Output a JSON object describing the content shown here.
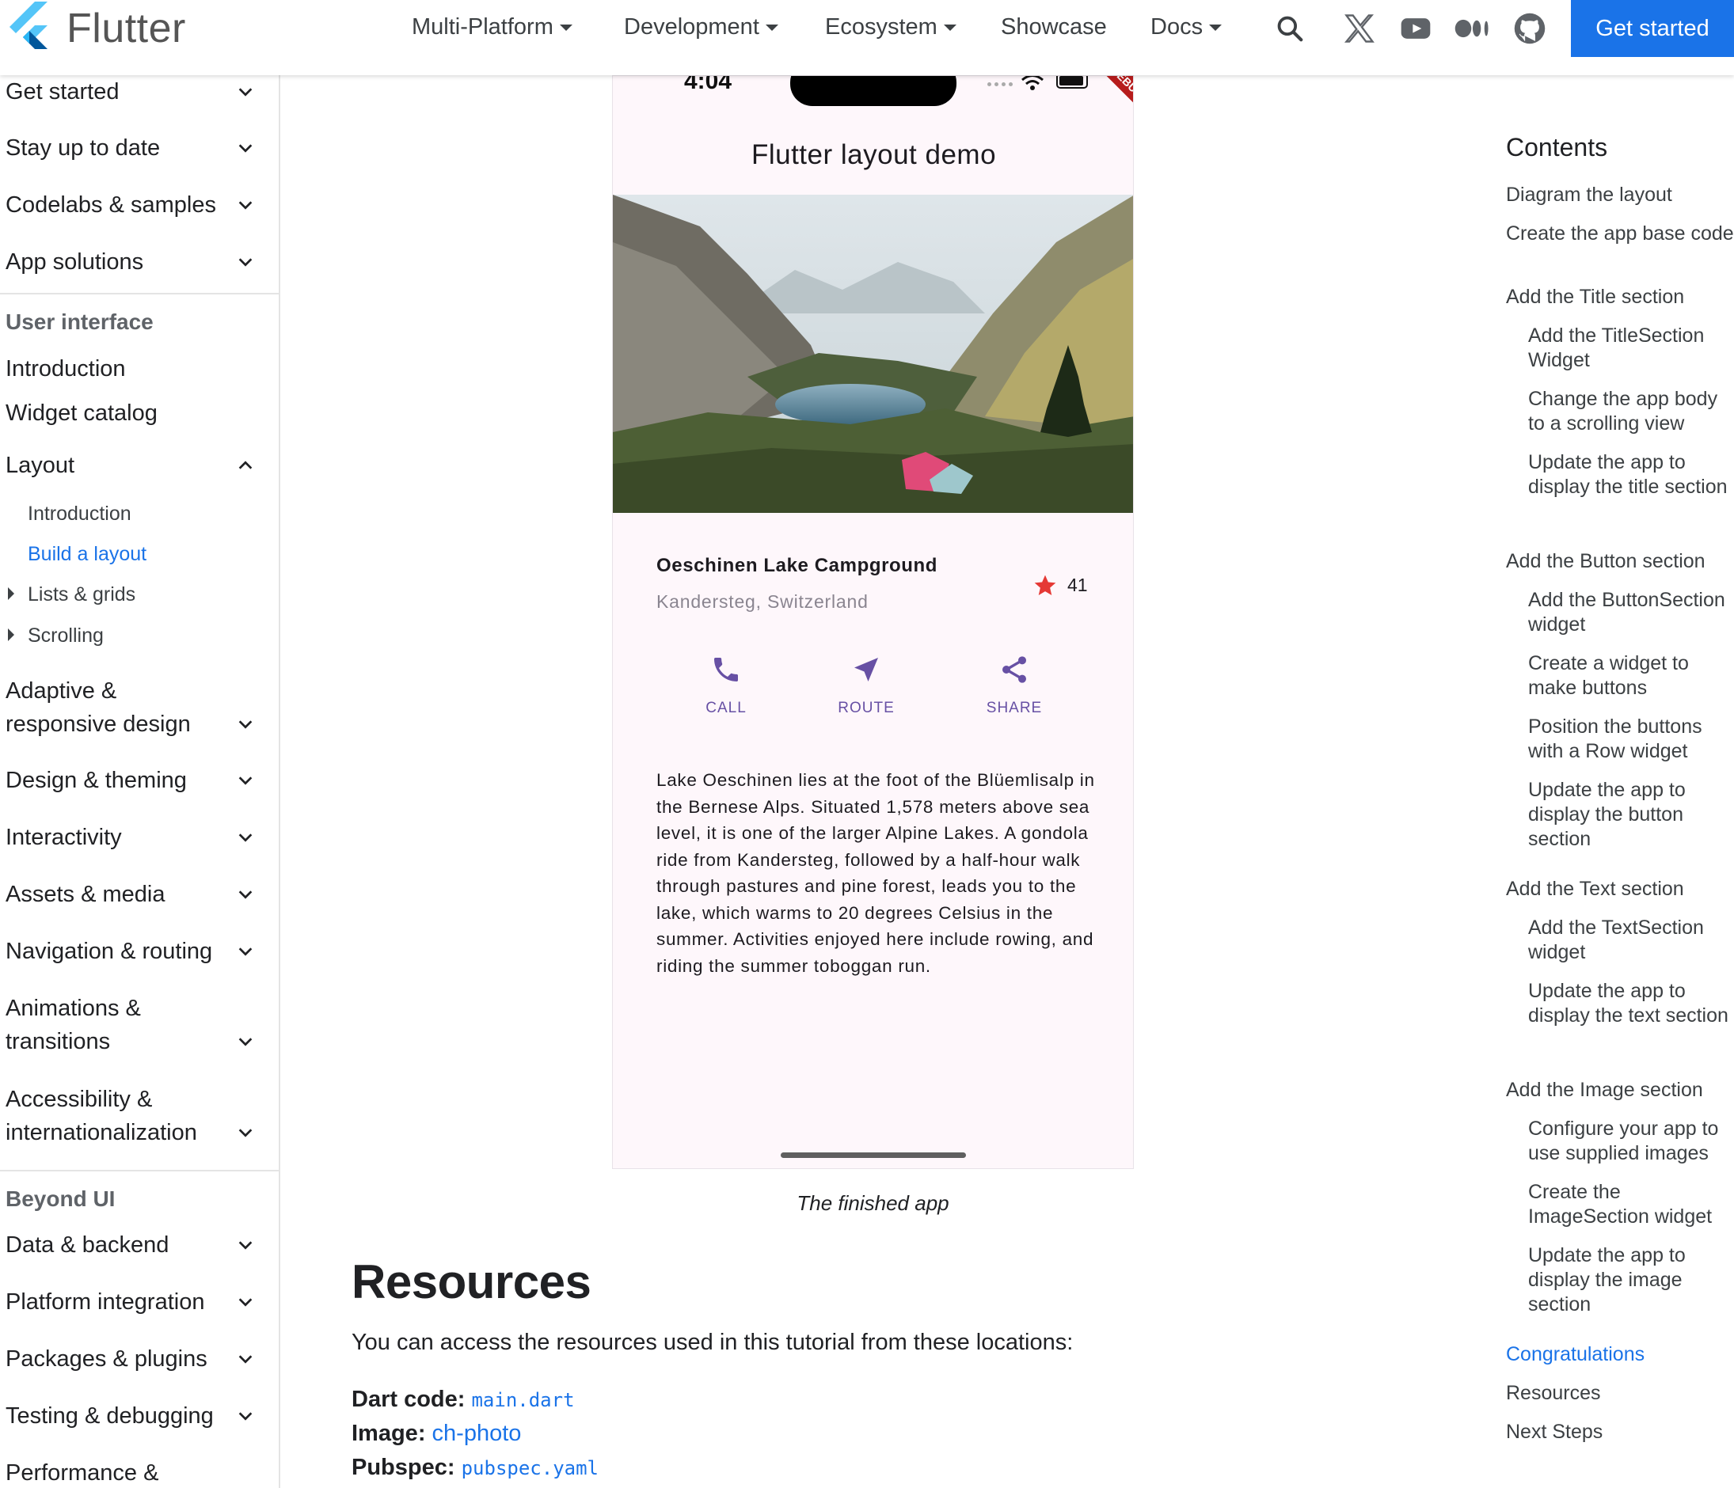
{
  "navbar": {
    "brand": "Flutter",
    "links": [
      {
        "label": "Multi-Platform",
        "dropdown": true
      },
      {
        "label": "Development",
        "dropdown": true
      },
      {
        "label": "Ecosystem",
        "dropdown": true
      },
      {
        "label": "Showcase",
        "dropdown": false
      },
      {
        "label": "Docs",
        "dropdown": true
      }
    ],
    "icons": [
      "search-icon",
      "x-icon",
      "youtube-icon",
      "medium-icon",
      "github-icon"
    ],
    "cta": "Get started"
  },
  "sidebar": {
    "top_items": [
      "Get started",
      "Stay up to date",
      "Codelabs & samples",
      "App solutions"
    ],
    "section1": "User interface",
    "ui_items": [
      "Introduction",
      "Widget catalog"
    ],
    "layout": {
      "label": "Layout",
      "children": [
        "Introduction",
        "Build a layout",
        "Lists & grids",
        "Scrolling"
      ]
    },
    "ui_more": [
      {
        "label": "Adaptive & responsive design",
        "line1": "Adaptive &",
        "line2": "responsive design"
      },
      {
        "label": "Design & theming"
      },
      {
        "label": "Interactivity"
      },
      {
        "label": "Assets & media"
      },
      {
        "label": "Navigation & routing"
      },
      {
        "label": "Animations & transitions",
        "line1": "Animations &",
        "line2": "transitions"
      },
      {
        "label": "Accessibility & internationalization",
        "line1": "Accessibility &",
        "line2": "internationalization"
      }
    ],
    "section2": "Beyond UI",
    "beyond_items": [
      "Data & backend",
      "Platform integration",
      "Packages & plugins",
      "Testing & debugging",
      "Performance &"
    ]
  },
  "phone": {
    "time": "4:04",
    "debug_banner": "DEBUG",
    "app_title": "Flutter layout demo",
    "place_name": "Oeschinen Lake Campground",
    "place_location": "Kandersteg, Switzerland",
    "star_count": "41",
    "actions": [
      "CALL",
      "ROUTE",
      "SHARE"
    ],
    "description": "Lake Oeschinen lies at the foot of the Blüemlisalp in the Bernese Alps. Situated 1,578 meters above sea level, it is one of the larger Alpine Lakes. A gondola ride from Kandersteg, followed by a half-hour walk through pastures and pine forest, leads you to the lake, which warms to 20 degrees Celsius in the summer. Activities enjoyed here include rowing, and riding the summer toboggan run."
  },
  "caption": "The finished app",
  "resources": {
    "heading": "Resources",
    "intro": "You can access the resources used in this tutorial from these locations:",
    "rows": [
      {
        "label": "Dart code:",
        "link": "main.dart"
      },
      {
        "label": "Image:",
        "link": "ch-photo"
      },
      {
        "label": "Pubspec:",
        "link": "pubspec.yaml"
      }
    ]
  },
  "toc": {
    "heading": "Contents",
    "items": [
      "Diagram the layout",
      "Create the app base code",
      "Add the Title section",
      "Add the TitleSection Widget",
      "Change the app body to a scrolling view",
      "Update the app to display the title section",
      "Add the Button section",
      "Add the ButtonSection widget",
      "Create a widget to make buttons",
      "Position the buttons with a Row widget",
      "Update the app to display the button section",
      "Add the Text section",
      "Add the TextSection widget",
      "Update the app to display the text section",
      "Add the Image section",
      "Configure your app to use supplied images",
      "Create the ImageSection widget",
      "Update the app to display the image section",
      "Congratulations",
      "Resources",
      "Next Steps"
    ],
    "active": "Congratulations"
  },
  "colors": {
    "accent": "#1a73e8",
    "app_purple": "#6750a4",
    "star": "#e53935",
    "app_background": "#fef7fb"
  }
}
